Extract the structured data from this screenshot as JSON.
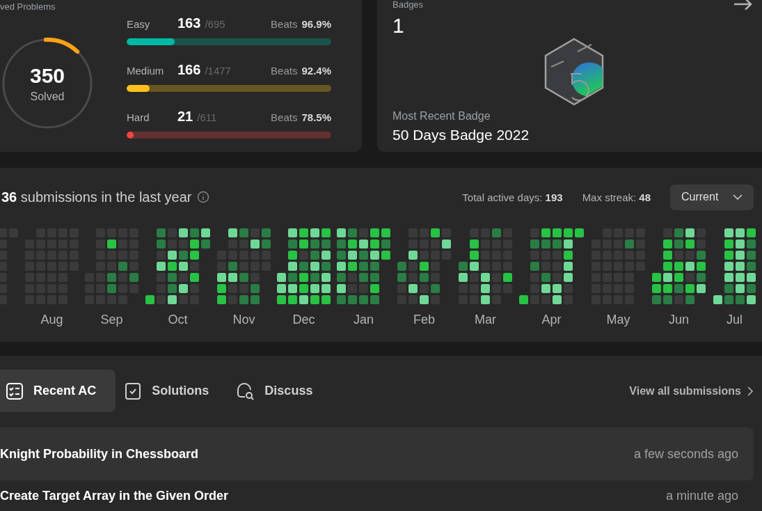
{
  "problems": {
    "heading": "ved Problems",
    "ring": {
      "value": "350",
      "label": "Solved"
    },
    "levels": [
      {
        "name": "Easy",
        "solved": "163",
        "total": "/695",
        "beats_label": "Beats",
        "beats": "96.9%",
        "level": 0.235,
        "color": "#00b8a3"
      },
      {
        "name": "Medium",
        "solved": "166",
        "total": "/1477",
        "beats_label": "Beats",
        "beats": "92.4%",
        "level": 0.112,
        "color": "#ffc01e"
      },
      {
        "name": "Hard",
        "solved": "21",
        "total": "/611",
        "beats_label": "Beats",
        "beats": "78.5%",
        "level": 0.034,
        "color": "#ef4743"
      }
    ]
  },
  "badges": {
    "heading": "Badges",
    "count": "1",
    "recent_label": "Most Recent Badge",
    "recent_name": "50 Days Badge 2022"
  },
  "activity": {
    "heading": "**36** submissions in the last year",
    "stats": [
      "Total active days: **193**",
      "Max streak: **48**"
    ],
    "dropdown": "Current",
    "months": [
      "Aug",
      "Sep",
      "Oct",
      "Nov",
      "Dec",
      "Jan",
      "Feb",
      "Mar",
      "Apr",
      "May",
      "Jun",
      "Jul"
    ]
  },
  "tabs": [
    {
      "label": "Recent AC",
      "selected": true
    },
    {
      "label": "Solutions",
      "selected": false
    },
    {
      "label": "Discuss",
      "selected": false
    }
  ],
  "view_all": "View all submissions",
  "submissions": [
    {
      "title": "Knight Probability in Chessboard",
      "time": "a few seconds ago"
    },
    {
      "title": "Create Target Array in the Given Order",
      "time": "a minute ago"
    }
  ]
}
